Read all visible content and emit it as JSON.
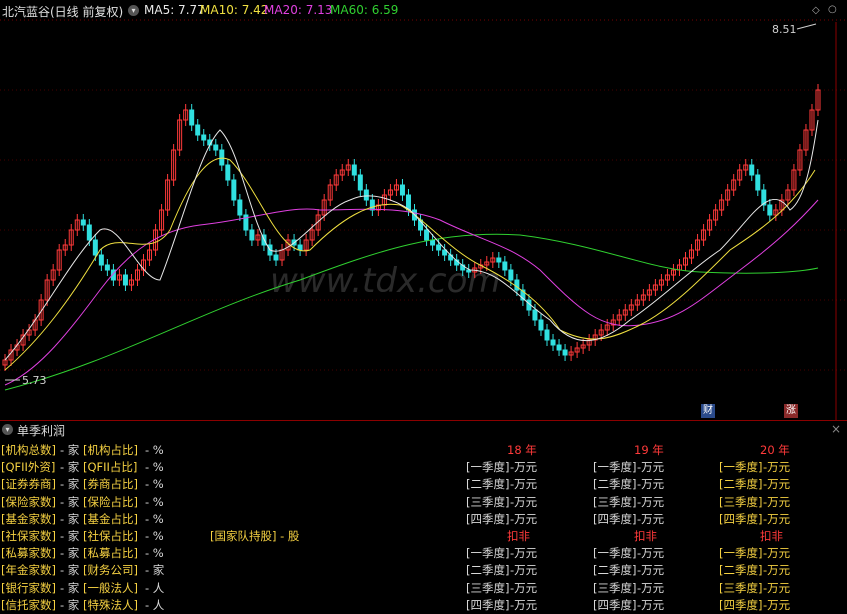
{
  "header": {
    "stock": "北汽蓝谷(日线 前复权)",
    "ma5": "MA5: 7.77",
    "ma10": "MA10: 7.42",
    "ma20": "MA20: 7.13",
    "ma60": "MA60: 6.59",
    "colors": {
      "ma5": "#e8e8e8",
      "ma10": "#f0e040",
      "ma20": "#e040e0",
      "ma60": "#30d030"
    }
  },
  "chart": {
    "high_label": "8.51",
    "low_label": "5.73",
    "watermark": "www.tdx.com",
    "badge_cai": "财",
    "badge_zhang": "涨",
    "colors": {
      "up": "#ff3a3a",
      "down": "#30e0e0"
    }
  },
  "panel": {
    "title": "单季利润",
    "close": "×",
    "left_rows": [
      {
        "a": "[机构总数]",
        "b": "- 家",
        "c": "[机构占比]",
        "d": "- %"
      },
      {
        "a": "[QFII外资]",
        "b": "- 家",
        "c": "[QFII占比]",
        "d": "- %"
      },
      {
        "a": "[证券券商]",
        "b": "- 家",
        "c": "[券商占比]",
        "d": "- %"
      },
      {
        "a": "[保险家数]",
        "b": "- 家",
        "c": "[保险占比]",
        "d": "- %"
      },
      {
        "a": "[基金家数]",
        "b": "- 家",
        "c": "[基金占比]",
        "d": "- %"
      },
      {
        "a": "[社保家数]",
        "b": "- 家",
        "c": "[社保占比]",
        "d": "- %"
      },
      {
        "a": "[私募家数]",
        "b": "- 家",
        "c": "[私募占比]",
        "d": "- %"
      },
      {
        "a": "[年金家数]",
        "b": "- 家",
        "c": "[财务公司]",
        "d": "- 家"
      },
      {
        "a": "[银行家数]",
        "b": "- 家",
        "c": "[一般法人]",
        "d": "- 人"
      },
      {
        "a": "[信托家数]",
        "b": "- 家",
        "c": "[特殊法人]",
        "d": "- 人"
      }
    ],
    "national_team": "[国家队持股] - 股",
    "years": [
      "18 年",
      "19 年",
      "20 年"
    ],
    "kou_fei": "扣非",
    "quarters": [
      "[一季度]",
      "[二季度]",
      "[三季度]",
      "[四季度]"
    ],
    "unit": "-万元"
  }
}
